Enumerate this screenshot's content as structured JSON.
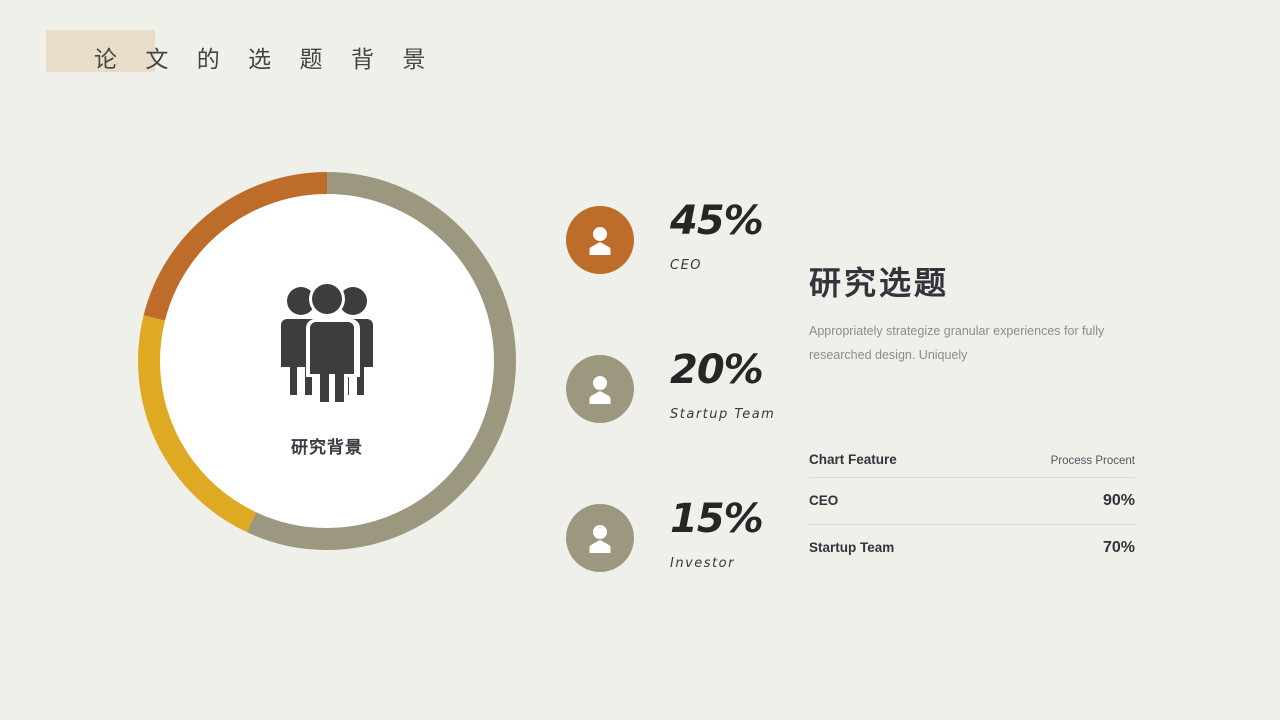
{
  "slide": {
    "background_color": "#EFF0E9",
    "title": "论  文  的  选  题  背  景",
    "title_highlight_color": "#E9DCC9"
  },
  "donut": {
    "center_label": "研究背景",
    "center_icon": "group-people-icon",
    "track_color": "#9C9880"
  },
  "chart_data": {
    "type": "pie",
    "title": "研究背景",
    "categories": [
      "CEO",
      "Startup Team",
      "Investor"
    ],
    "values": [
      45,
      20,
      15
    ],
    "colors": [
      "#BD6C2A",
      "#E0A924",
      "#9C9880"
    ],
    "units": "%",
    "legend": "right",
    "notes": "Donut chart: orange segment 45% (CEO), yellow segment 20% (Startup Team), olive-gray remainder shown for Investor 15%"
  },
  "stats": [
    {
      "value": "45%",
      "name": "CEO",
      "icon": "person-icon",
      "badge_color": "#BD6C2A"
    },
    {
      "value": "20%",
      "name": "Startup Team",
      "icon": "person-icon",
      "badge_color": "#9C9880"
    },
    {
      "value": "15%",
      "name": "Investor",
      "icon": "person-icon",
      "badge_color": "#9C9880"
    }
  ],
  "right_panel": {
    "heading": "研究选题",
    "body": "Appropriately strategize granular experiences for fully researched design. Uniquely"
  },
  "feature_table": {
    "header": {
      "label": "Chart Feature",
      "value": "Process Procent"
    },
    "rows": [
      {
        "label": "CEO",
        "value": "90%"
      },
      {
        "label": "Startup Team",
        "value": "70%"
      }
    ]
  }
}
